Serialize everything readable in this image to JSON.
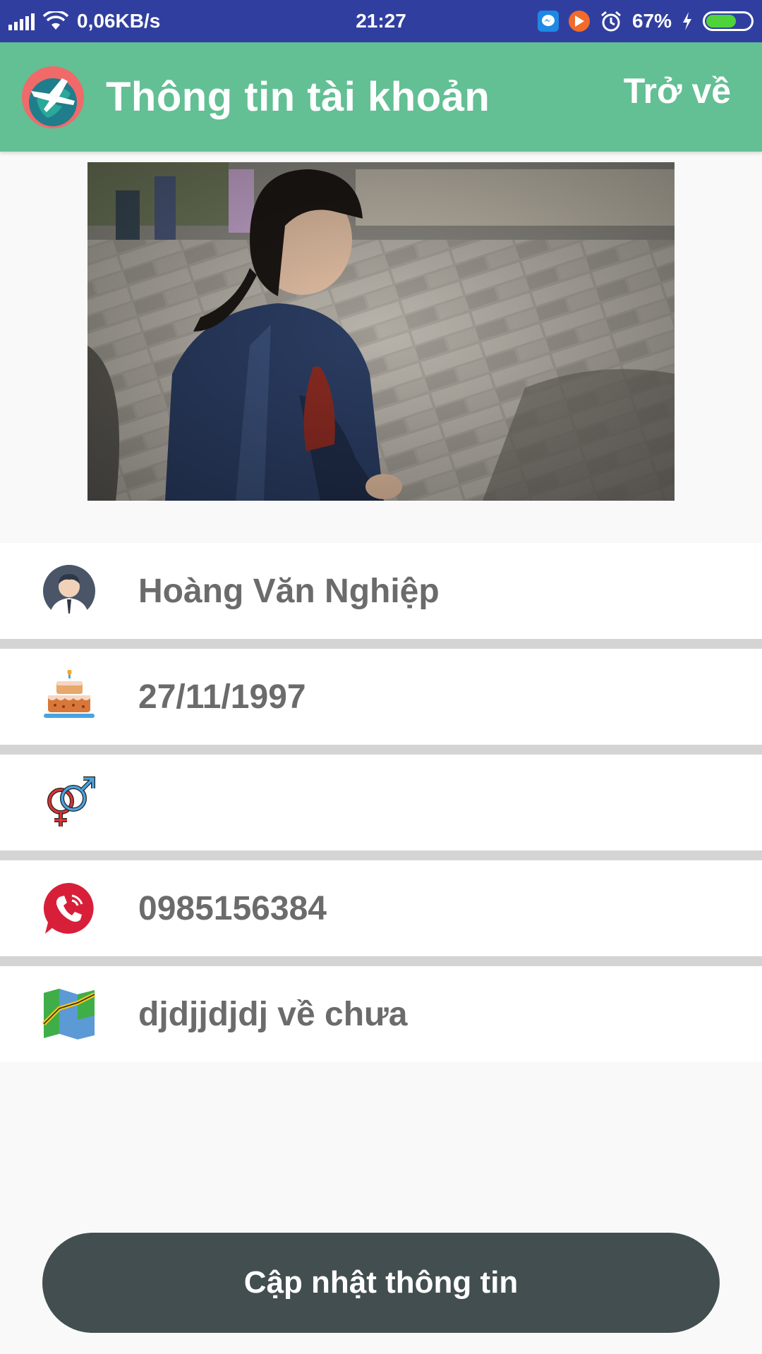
{
  "status_bar": {
    "network_speed": "0,06KB/s",
    "time": "21:27",
    "battery_percent": "67%",
    "battery_level": 0.67,
    "icons": [
      "signal-icon",
      "wifi-icon",
      "messenger-icon",
      "video-app-icon",
      "alarm-icon",
      "charging-icon",
      "battery-icon"
    ]
  },
  "app_bar": {
    "title": "Thông tin tài khoản",
    "back_label": "Trở về",
    "background_color": "#63bf94"
  },
  "profile": {
    "photo": "profile-photo",
    "fields": [
      {
        "icon": "user-avatar-icon",
        "value": "Hoàng Văn Nghiệp"
      },
      {
        "icon": "birthday-cake-icon",
        "value": "27/11/1997"
      },
      {
        "icon": "gender-icon",
        "value": ""
      },
      {
        "icon": "phone-icon",
        "value": "0985156384"
      },
      {
        "icon": "map-icon",
        "value": "djdjjdjdj về chưa"
      }
    ]
  },
  "actions": {
    "update_label": "Cập nhật thông tin",
    "button_color": "#434e50"
  }
}
